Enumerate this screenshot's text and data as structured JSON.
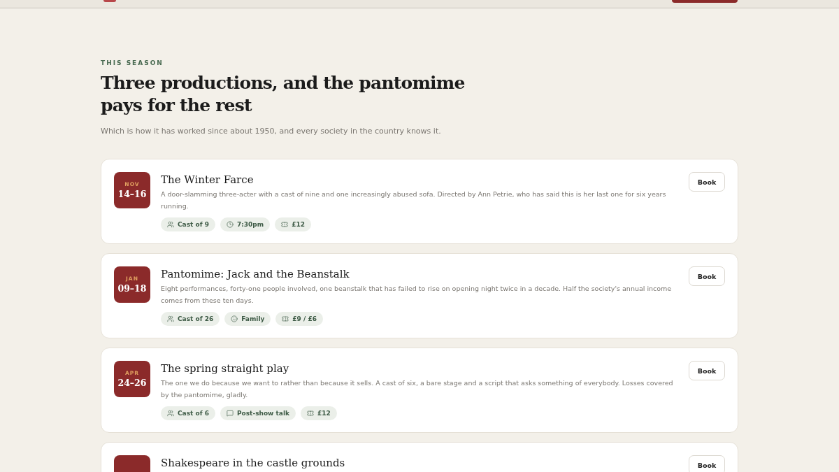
{
  "header": {
    "has_logo": true,
    "has_button": true
  },
  "intro": {
    "eyebrow": "THIS SEASON",
    "title": "Three productions, and the pantomime pays for the rest",
    "subtitle": "Which is how it has worked since about 1950, and every society in the country knows it."
  },
  "productions": [
    {
      "month": "NOV",
      "days": "14–16",
      "title": "The Winter Farce",
      "description": "A door-slamming three-acter with a cast of nine and one increasingly abused sofa. Directed by Ann Petrie, who has said this is her last one for six years running.",
      "button": "Book",
      "chips": [
        {
          "kind": "people",
          "label": "Cast of 9"
        },
        {
          "kind": "time",
          "label": "7:30pm"
        },
        {
          "kind": "ticket",
          "label": "£12"
        }
      ]
    },
    {
      "month": "JAN",
      "days": "09–18",
      "title": "Pantomime: Jack and the Beanstalk",
      "description": "Eight performances, forty-one people involved, one beanstalk that has failed to rise on opening night twice in a decade. Half the society's annual income comes from these ten days.",
      "button": "Book",
      "chips": [
        {
          "kind": "people",
          "label": "Cast of 26"
        },
        {
          "kind": "smile",
          "label": "Family"
        },
        {
          "kind": "ticket",
          "label": "£9 / £6"
        }
      ]
    },
    {
      "month": "APR",
      "days": "24–26",
      "title": "The spring straight play",
      "description": "The one we do because we want to rather than because it sells. A cast of six, a bare stage and a script that asks something of everybody. Losses covered by the pantomime, gladly.",
      "button": "Book",
      "chips": [
        {
          "kind": "people",
          "label": "Cast of 6"
        },
        {
          "kind": "talk",
          "label": "Post-show talk"
        },
        {
          "kind": "ticket",
          "label": "£12"
        }
      ]
    },
    {
      "title": "Shakespeare in the castle grounds",
      "button": "Book"
    }
  ]
}
